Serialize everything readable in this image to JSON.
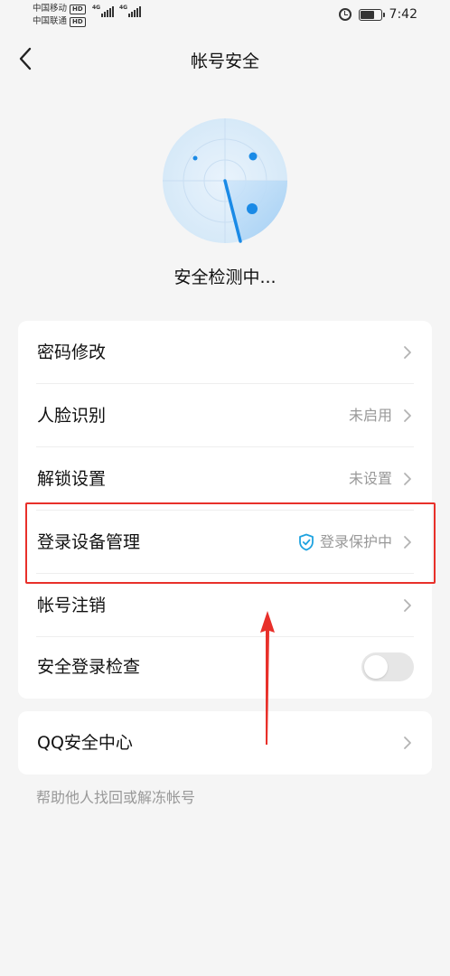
{
  "status_bar": {
    "carrier1": "中国移动",
    "carrier2": "中国联通",
    "hd": "HD",
    "net1": "4G",
    "net2": "4G",
    "time": "7:42"
  },
  "nav": {
    "title": "帐号安全",
    "back_icon": "chevron-left-icon"
  },
  "scan": {
    "status": "安全检测中..."
  },
  "settings": {
    "items": [
      {
        "label": "密码修改",
        "value": ""
      },
      {
        "label": "人脸识别",
        "value": "未启用"
      },
      {
        "label": "解锁设置",
        "value": "未设置"
      },
      {
        "label": "登录设备管理",
        "value": "登录保护中",
        "icon": "shield-check-icon"
      },
      {
        "label": "帐号注销",
        "value": ""
      },
      {
        "label": "安全登录检查",
        "toggle": false
      }
    ]
  },
  "qq_center": {
    "label": "QQ安全中心"
  },
  "help_link": "帮助他人找回或解冻帐号",
  "colors": {
    "background": "#f5f5f5",
    "accent": "#1a8ae6",
    "shield": "#1fa3e0",
    "annotation": "#e8302a"
  }
}
